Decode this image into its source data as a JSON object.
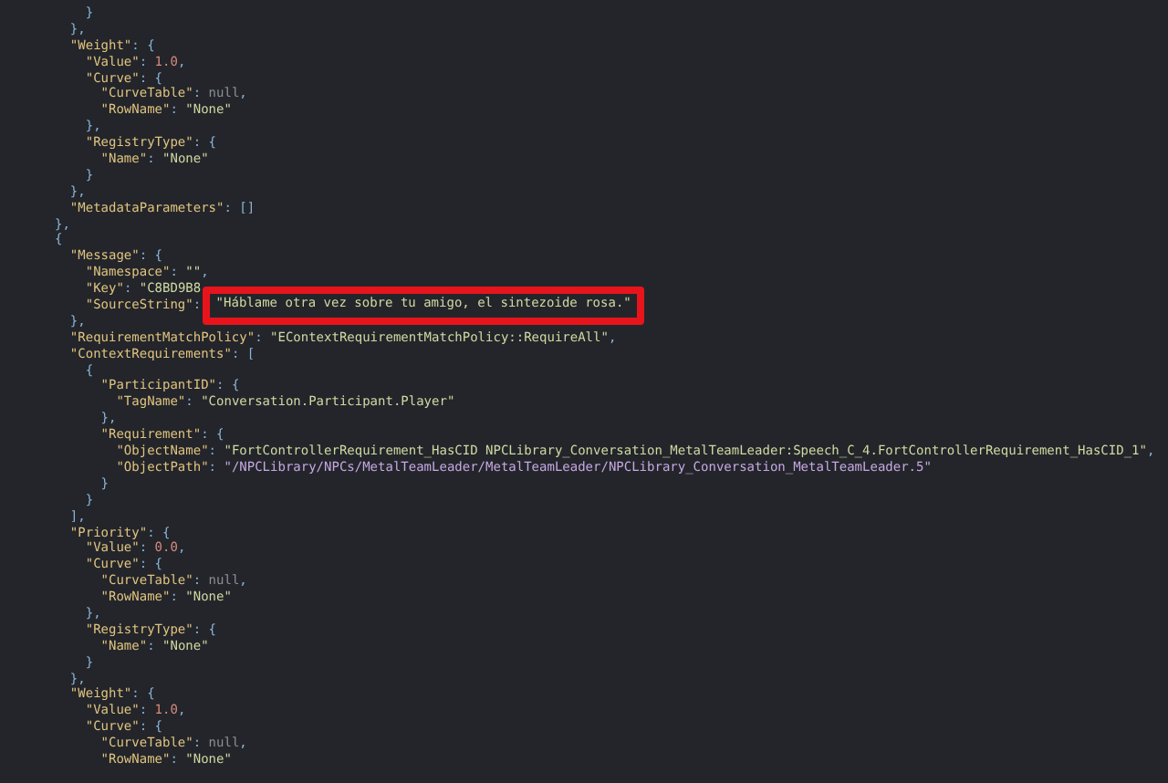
{
  "editor": {
    "lines": [
      {
        "tokens": [
          {
            "kind": "punct",
            "text": "    }"
          }
        ]
      },
      {
        "tokens": [
          {
            "kind": "punct",
            "text": "  },"
          }
        ]
      },
      {
        "tokens": [
          {
            "kind": "key",
            "text": "  \"Weight\""
          },
          {
            "kind": "punct",
            "text": ": {"
          }
        ]
      },
      {
        "tokens": [
          {
            "kind": "key",
            "text": "    \"Value\""
          },
          {
            "kind": "punct",
            "text": ": "
          },
          {
            "kind": "number",
            "text": "1.0"
          },
          {
            "kind": "punct",
            "text": ","
          }
        ]
      },
      {
        "tokens": [
          {
            "kind": "key",
            "text": "    \"Curve\""
          },
          {
            "kind": "punct",
            "text": ": {"
          }
        ]
      },
      {
        "tokens": [
          {
            "kind": "key",
            "text": "      \"CurveTable\""
          },
          {
            "kind": "punct",
            "text": ": "
          },
          {
            "kind": "null",
            "text": "null"
          },
          {
            "kind": "punct",
            "text": ","
          }
        ]
      },
      {
        "tokens": [
          {
            "kind": "key",
            "text": "      \"RowName\""
          },
          {
            "kind": "punct",
            "text": ": "
          },
          {
            "kind": "string",
            "text": "\"None\""
          }
        ]
      },
      {
        "tokens": [
          {
            "kind": "punct",
            "text": "    },"
          }
        ]
      },
      {
        "tokens": [
          {
            "kind": "key",
            "text": "    \"RegistryType\""
          },
          {
            "kind": "punct",
            "text": ": {"
          }
        ]
      },
      {
        "tokens": [
          {
            "kind": "key",
            "text": "      \"Name\""
          },
          {
            "kind": "punct",
            "text": ": "
          },
          {
            "kind": "string",
            "text": "\"None\""
          }
        ]
      },
      {
        "tokens": [
          {
            "kind": "punct",
            "text": "    }"
          }
        ]
      },
      {
        "tokens": [
          {
            "kind": "punct",
            "text": "  },"
          }
        ]
      },
      {
        "tokens": [
          {
            "kind": "key",
            "text": "  \"MetadataParameters\""
          },
          {
            "kind": "punct",
            "text": ": []"
          }
        ]
      },
      {
        "tokens": [
          {
            "kind": "punct",
            "text": "},"
          }
        ]
      },
      {
        "tokens": [
          {
            "kind": "punct",
            "text": "{"
          }
        ]
      },
      {
        "tokens": [
          {
            "kind": "key",
            "text": "  \"Message\""
          },
          {
            "kind": "punct",
            "text": ": {"
          }
        ]
      },
      {
        "tokens": [
          {
            "kind": "key",
            "text": "    \"Namespace\""
          },
          {
            "kind": "punct",
            "text": ": "
          },
          {
            "kind": "string",
            "text": "\"\""
          },
          {
            "kind": "punct",
            "text": ","
          }
        ]
      },
      {
        "tokens": [
          {
            "kind": "key",
            "text": "    \"Key\""
          },
          {
            "kind": "punct",
            "text": ": "
          },
          {
            "kind": "string",
            "text": "\"C8BD9B8"
          }
        ]
      },
      {
        "tokens": [
          {
            "kind": "key",
            "text": "    \"SourceString\""
          },
          {
            "kind": "punct",
            "text": ": "
          },
          {
            "kind": "string",
            "text": "\"Háblame otra vez sobre tu amigo, el sintezoide rosa.\"",
            "highlighted": true
          }
        ]
      },
      {
        "tokens": [
          {
            "kind": "punct",
            "text": "  },"
          }
        ]
      },
      {
        "tokens": [
          {
            "kind": "key",
            "text": "  \"RequirementMatchPolicy\""
          },
          {
            "kind": "punct",
            "text": ": "
          },
          {
            "kind": "string",
            "text": "\"EContextRequirementMatchPolicy::RequireAll\""
          },
          {
            "kind": "punct",
            "text": ","
          }
        ]
      },
      {
        "tokens": [
          {
            "kind": "key",
            "text": "  \"ContextRequirements\""
          },
          {
            "kind": "punct",
            "text": ": ["
          }
        ]
      },
      {
        "tokens": [
          {
            "kind": "punct",
            "text": "    {"
          }
        ]
      },
      {
        "tokens": [
          {
            "kind": "key",
            "text": "      \"ParticipantID\""
          },
          {
            "kind": "punct",
            "text": ": {"
          }
        ]
      },
      {
        "tokens": [
          {
            "kind": "key",
            "text": "        \"TagName\""
          },
          {
            "kind": "punct",
            "text": ": "
          },
          {
            "kind": "string",
            "text": "\"Conversation.Participant.Player\""
          }
        ]
      },
      {
        "tokens": [
          {
            "kind": "punct",
            "text": "      },"
          }
        ]
      },
      {
        "tokens": [
          {
            "kind": "key",
            "text": "      \"Requirement\""
          },
          {
            "kind": "punct",
            "text": ": {"
          }
        ]
      },
      {
        "tokens": [
          {
            "kind": "key",
            "text": "        \"ObjectName\""
          },
          {
            "kind": "punct",
            "text": ": "
          },
          {
            "kind": "string",
            "text": "\"FortControllerRequirement_HasCID NPCLibrary_Conversation_MetalTeamLeader:Speech_C_4.FortControllerRequirement_HasCID_1\""
          },
          {
            "kind": "punct",
            "text": ","
          }
        ]
      },
      {
        "tokens": [
          {
            "kind": "key",
            "text": "        \"ObjectPath\""
          },
          {
            "kind": "punct",
            "text": ": "
          },
          {
            "kind": "path",
            "text": "\"/NPCLibrary/NPCs/MetalTeamLeader/MetalTeamLeader/NPCLibrary_Conversation_MetalTeamLeader.5\""
          }
        ]
      },
      {
        "tokens": [
          {
            "kind": "punct",
            "text": "      }"
          }
        ]
      },
      {
        "tokens": [
          {
            "kind": "punct",
            "text": "    }"
          }
        ]
      },
      {
        "tokens": [
          {
            "kind": "punct",
            "text": "  ],"
          }
        ]
      },
      {
        "tokens": [
          {
            "kind": "key",
            "text": "  \"Priority\""
          },
          {
            "kind": "punct",
            "text": ": {"
          }
        ]
      },
      {
        "tokens": [
          {
            "kind": "key",
            "text": "    \"Value\""
          },
          {
            "kind": "punct",
            "text": ": "
          },
          {
            "kind": "number",
            "text": "0.0"
          },
          {
            "kind": "punct",
            "text": ","
          }
        ]
      },
      {
        "tokens": [
          {
            "kind": "key",
            "text": "    \"Curve\""
          },
          {
            "kind": "punct",
            "text": ": {"
          }
        ]
      },
      {
        "tokens": [
          {
            "kind": "key",
            "text": "      \"CurveTable\""
          },
          {
            "kind": "punct",
            "text": ": "
          },
          {
            "kind": "null",
            "text": "null"
          },
          {
            "kind": "punct",
            "text": ","
          }
        ]
      },
      {
        "tokens": [
          {
            "kind": "key",
            "text": "      \"RowName\""
          },
          {
            "kind": "punct",
            "text": ": "
          },
          {
            "kind": "string",
            "text": "\"None\""
          }
        ]
      },
      {
        "tokens": [
          {
            "kind": "punct",
            "text": "    },"
          }
        ]
      },
      {
        "tokens": [
          {
            "kind": "key",
            "text": "    \"RegistryType\""
          },
          {
            "kind": "punct",
            "text": ": {"
          }
        ]
      },
      {
        "tokens": [
          {
            "kind": "key",
            "text": "      \"Name\""
          },
          {
            "kind": "punct",
            "text": ": "
          },
          {
            "kind": "string",
            "text": "\"None\""
          }
        ]
      },
      {
        "tokens": [
          {
            "kind": "punct",
            "text": "    }"
          }
        ]
      },
      {
        "tokens": [
          {
            "kind": "punct",
            "text": "  },"
          }
        ]
      },
      {
        "tokens": [
          {
            "kind": "key",
            "text": "  \"Weight\""
          },
          {
            "kind": "punct",
            "text": ": {"
          }
        ]
      },
      {
        "tokens": [
          {
            "kind": "key",
            "text": "    \"Value\""
          },
          {
            "kind": "punct",
            "text": ": "
          },
          {
            "kind": "number",
            "text": "1.0"
          },
          {
            "kind": "punct",
            "text": ","
          }
        ]
      },
      {
        "tokens": [
          {
            "kind": "key",
            "text": "    \"Curve\""
          },
          {
            "kind": "punct",
            "text": ": {"
          }
        ]
      },
      {
        "tokens": [
          {
            "kind": "key",
            "text": "      \"CurveTable\""
          },
          {
            "kind": "punct",
            "text": ": "
          },
          {
            "kind": "null",
            "text": "null"
          },
          {
            "kind": "punct",
            "text": ","
          }
        ]
      },
      {
        "tokens": [
          {
            "kind": "key",
            "text": "      \"RowName\""
          },
          {
            "kind": "punct",
            "text": ": "
          },
          {
            "kind": "string",
            "text": "\"None\""
          }
        ]
      }
    ]
  }
}
